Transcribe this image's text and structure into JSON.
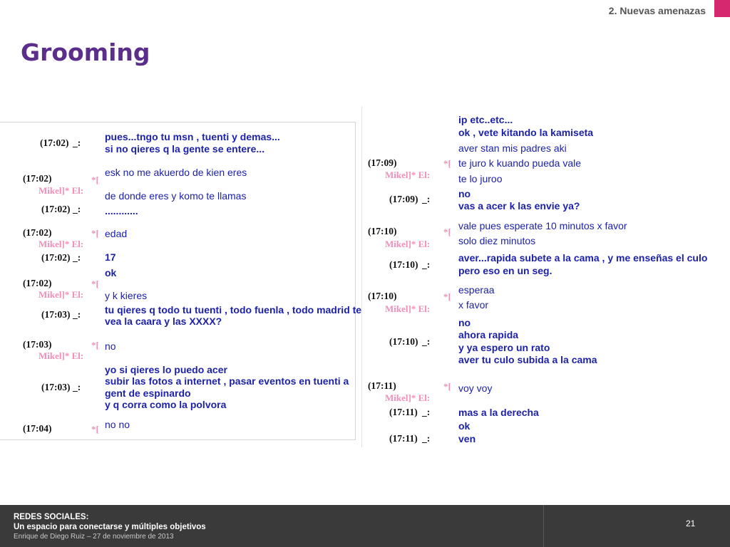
{
  "header": {
    "section": "2. Nuevas amenazas",
    "title": "Grooming",
    "accent_color": "#d6286e",
    "title_color": "#5b2e8c"
  },
  "chat_left": {
    "times": [
      "(17:02)",
      "(17:02)",
      "(17:02)",
      "(17:02)",
      "(17:02)",
      "(17:02)",
      "(17:03)",
      "(17:03)",
      "(17:03)",
      "(17:04)"
    ],
    "nick_labels": [
      "Mikel]* El:",
      "Mikel]* El:",
      "Mikel]* El:",
      "Mikel]* El:"
    ],
    "sep_labels": [
      "_:",
      "_:",
      "_:",
      "_:",
      "_:"
    ],
    "star_marks": [
      "*[",
      "*[",
      "*[",
      "*[",
      "*["
    ],
    "messages": [
      "pues...tngo tu msn , tuenti y demas...",
      "si no qieres q la gente se entere...",
      "esk no me akuerdo de kien eres",
      "de donde eres y komo te llamas",
      "............",
      "edad",
      "17",
      "ok",
      "y k kieres",
      "tu qieres q todo tu tuenti , todo fuenla , todo madrid te",
      "vea la caara y las XXXX?",
      "no",
      "yo si qieres lo puedo acer",
      "subir las fotos a internet  , pasar eventos en tuenti a",
      "gent de espinardo",
      "y q corra como la polvora",
      "no no"
    ]
  },
  "chat_right": {
    "times": [
      "(17:09)",
      "(17:09)",
      "(17:10)",
      "(17:10)",
      "(17:10)",
      "(17:10)",
      "(17:11)",
      "(17:11)",
      "(17:11)"
    ],
    "nick_labels": [
      "Mikel]* El:",
      "Mikel]* El:",
      "Mikel]* El:",
      "Mikel]* El:"
    ],
    "sep_labels": [
      "_:",
      "_:",
      "_:",
      "_:",
      "_:"
    ],
    "star_marks": [
      "*[",
      "*[",
      "*[",
      "*["
    ],
    "messages": [
      "ip etc..etc...",
      "ok , vete kitando la kamiseta",
      "aver stan mis padres aki",
      "te juro  k kuando pueda vale",
      "te lo juroo",
      "no",
      "vas a acer k las envie ya?",
      "vale pues esperate 10 minutos x favor",
      "solo diez minutos",
      "aver...rapida subete a la cama , y me enseñas el culo",
      "pero eso en un seg.",
      "esperaa",
      "x favor",
      "no",
      "ahora rapida",
      "y ya espero un rato",
      "aver tu culo subida a la cama",
      "voy voy",
      "mas a la derecha",
      "ok",
      "ven"
    ]
  },
  "footer": {
    "line1": "REDES SOCIALES:",
    "line2": "Un espacio para conectarse y múltiples objetivos",
    "line3": "Enrique de Diego Ruiz – 27 de noviembre de 2013",
    "page_number": "21"
  }
}
